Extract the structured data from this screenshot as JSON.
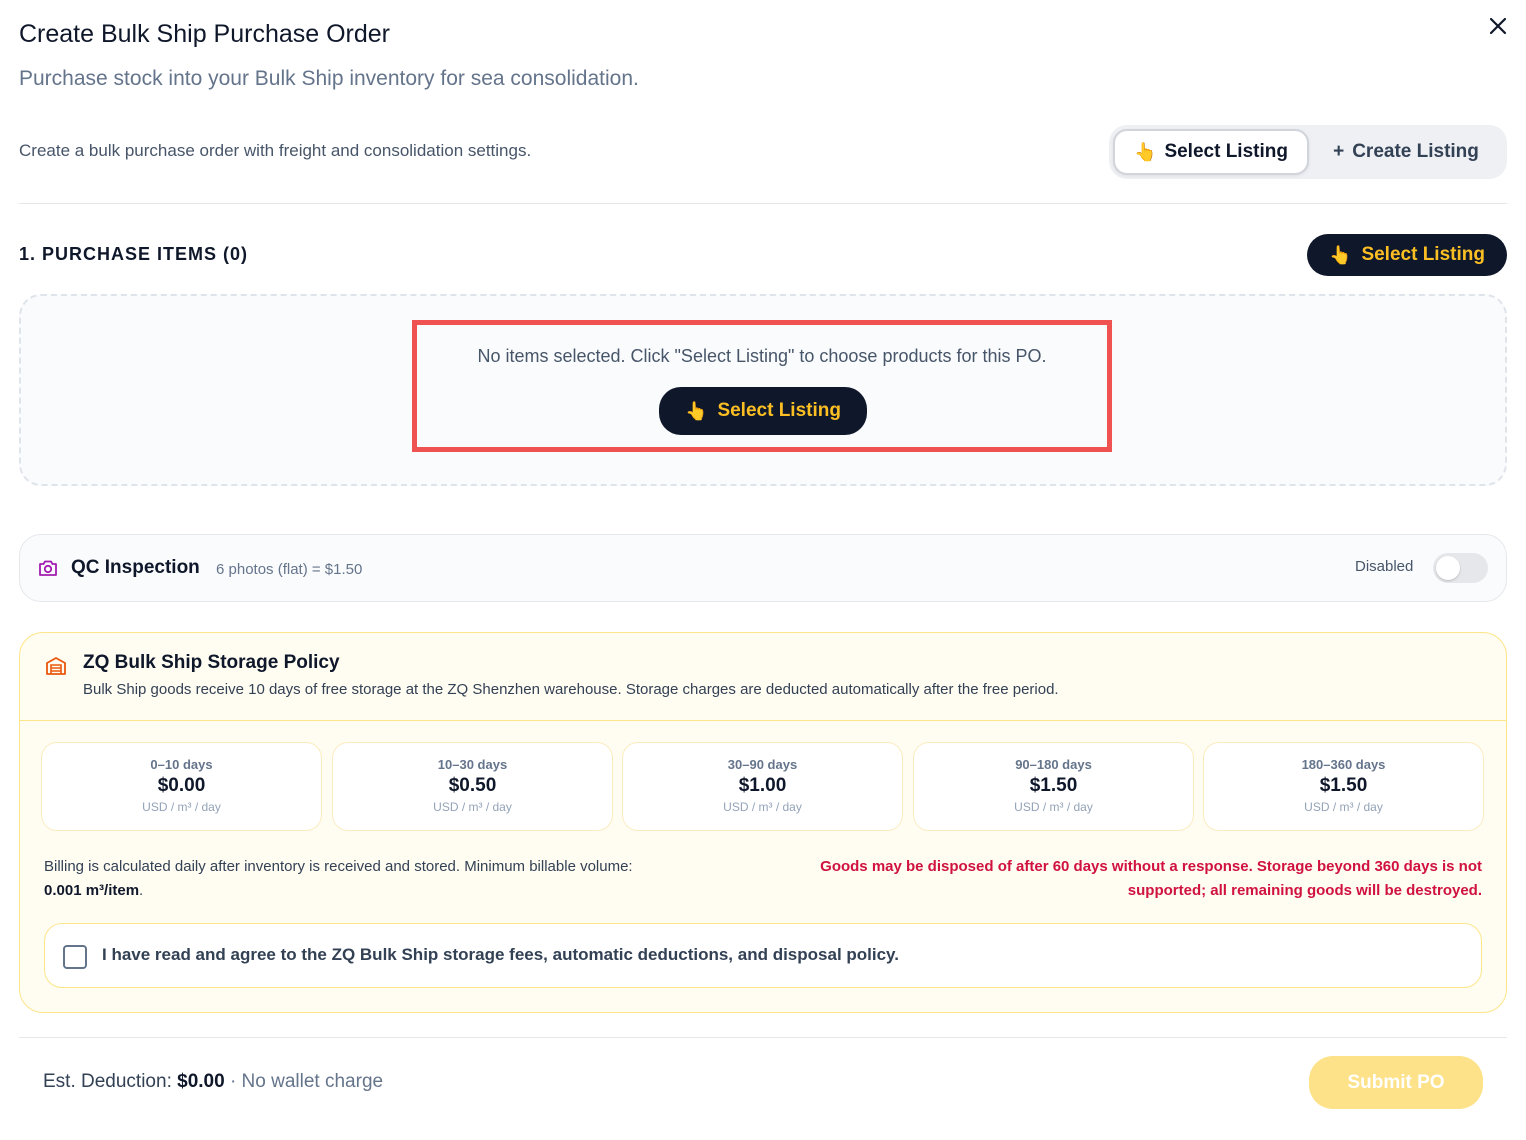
{
  "modal": {
    "title": "Create Bulk Ship Purchase Order",
    "subtitle": "Purchase stock into your Bulk Ship inventory for sea consolidation.",
    "intro": "Create a bulk purchase order with freight and consolidation settings."
  },
  "mode_toggle": {
    "select_label": "Select Listing",
    "select_icon": "👆",
    "create_label": "Create Listing",
    "create_icon": "+"
  },
  "purchase_items": {
    "title": "1. PURCHASE ITEMS (0)",
    "select_label": "Select Listing",
    "select_icon": "👆",
    "empty_message": "No items selected. Click \"Select Listing\" to choose products for this PO.",
    "empty_select_label": "Select Listing",
    "empty_select_icon": "👆"
  },
  "qc": {
    "title": "QC Inspection",
    "subtitle": "6 photos (flat) = $1.50",
    "state_label": "Disabled",
    "enabled": false,
    "icon": "camera-icon"
  },
  "storage_policy": {
    "title": "ZQ Bulk Ship Storage Policy",
    "description": "Bulk Ship goods receive 10 days of free storage at the ZQ Shenzhen warehouse. Storage charges are deducted automatically after the free period.",
    "icon": "warehouse-icon",
    "tiers": [
      {
        "range": "0–10 days",
        "price": "$0.00",
        "unit": "USD / m³ / day"
      },
      {
        "range": "10–30 days",
        "price": "$0.50",
        "unit": "USD / m³ / day"
      },
      {
        "range": "30–90 days",
        "price": "$1.00",
        "unit": "USD / m³ / day"
      },
      {
        "range": "90–180 days",
        "price": "$1.50",
        "unit": "USD / m³ / day"
      },
      {
        "range": "180–360 days",
        "price": "$1.50",
        "unit": "USD / m³ / day"
      }
    ],
    "billing_text": "Billing is calculated daily after inventory is received and stored. Minimum billable volume:",
    "billing_min": "0.001 m³/item",
    "billing_end": ".",
    "warning": "Goods may be disposed of after 60 days without a response. Storage beyond 360 days is not supported; all remaining goods will be destroyed.",
    "agreement": "I have read and agree to the ZQ Bulk Ship storage fees, automatic deductions, and disposal policy.",
    "agreed": false
  },
  "footer": {
    "est_label": "Est. Deduction:",
    "est_value": "$0.00",
    "est_note": "· No wallet charge",
    "submit_label": "Submit PO"
  },
  "colors": {
    "accent_dark": "#0f172a",
    "accent_yellow": "#fbbf24",
    "warning_red": "#d0123f",
    "highlight_red": "#f05252",
    "qc_icon": "#a21caf",
    "policy_icon": "#ea580c"
  }
}
